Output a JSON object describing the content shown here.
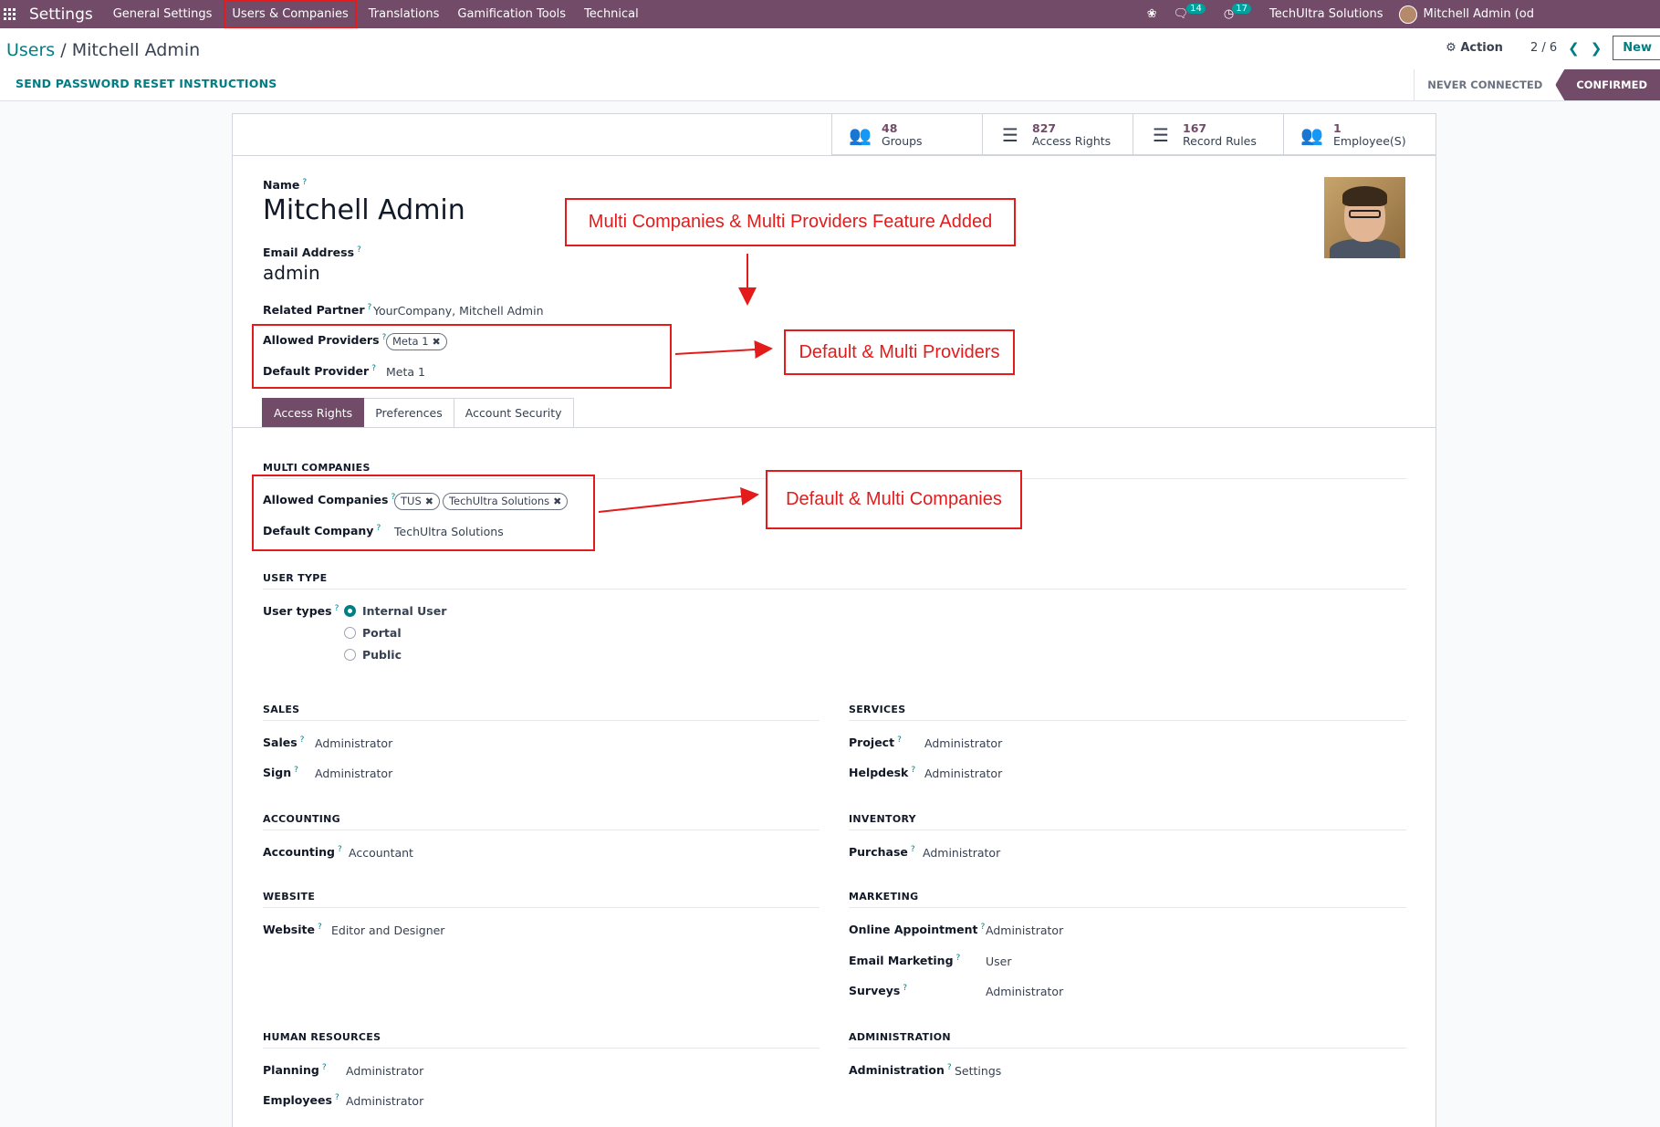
{
  "navbar": {
    "brand": "Settings",
    "menus": [
      "General Settings",
      "Users & Companies",
      "Translations",
      "Gamification Tools",
      "Technical"
    ],
    "messages_count": "14",
    "activities_count": "17",
    "company": "TechUltra Solutions",
    "user": "Mitchell Admin (od"
  },
  "control_panel": {
    "breadcrumb_parent": "Users",
    "breadcrumb_sep": "/",
    "breadcrumb_current": "Mitchell Admin",
    "action_label": "Action",
    "pager": "2 / 6",
    "new_label": "New",
    "reset_button": "SEND PASSWORD RESET INSTRUCTIONS",
    "status_never": "NEVER CONNECTED",
    "status_confirmed": "CONFIRMED"
  },
  "smart_buttons": [
    {
      "value": "48",
      "label": "Groups",
      "icon": "users-icon"
    },
    {
      "value": "827",
      "label": "Access Rights",
      "icon": "list-icon"
    },
    {
      "value": "167",
      "label": "Record Rules",
      "icon": "list-icon"
    },
    {
      "value": "1",
      "label": "Employee(S)",
      "icon": "users-icon"
    }
  ],
  "form": {
    "name_label": "Name",
    "name": "Mitchell Admin",
    "email_label": "Email Address",
    "email": "admin",
    "related_partner_label": "Related Partner",
    "related_partner": "YourCompany, Mitchell Admin",
    "allowed_providers_label": "Allowed Providers",
    "allowed_providers": [
      "Meta 1"
    ],
    "default_provider_label": "Default Provider",
    "default_provider": "Meta 1"
  },
  "tabs": [
    "Access Rights",
    "Preferences",
    "Account Security"
  ],
  "multi_companies": {
    "title": "MULTI COMPANIES",
    "allowed_label": "Allowed Companies",
    "allowed": [
      "TUS",
      "TechUltra Solutions"
    ],
    "default_label": "Default Company",
    "default": "TechUltra Solutions"
  },
  "user_type": {
    "title": "USER TYPE",
    "label": "User types",
    "options": [
      "Internal User",
      "Portal",
      "Public"
    ],
    "selected": "Internal User"
  },
  "sections": {
    "sales": {
      "title": "SALES",
      "rows": [
        {
          "label": "Sales",
          "value": "Administrator"
        },
        {
          "label": "Sign",
          "value": "Administrator"
        }
      ]
    },
    "services": {
      "title": "SERVICES",
      "rows": [
        {
          "label": "Project",
          "value": "Administrator"
        },
        {
          "label": "Helpdesk",
          "value": "Administrator"
        }
      ]
    },
    "accounting": {
      "title": "ACCOUNTING",
      "rows": [
        {
          "label": "Accounting",
          "value": "Accountant"
        }
      ]
    },
    "inventory": {
      "title": "INVENTORY",
      "rows": [
        {
          "label": "Purchase",
          "value": "Administrator"
        }
      ]
    },
    "website": {
      "title": "WEBSITE",
      "rows": [
        {
          "label": "Website",
          "value": "Editor and Designer"
        }
      ]
    },
    "marketing": {
      "title": "MARKETING",
      "rows": [
        {
          "label": "Online Appointment",
          "value": "Administrator"
        },
        {
          "label": "Email Marketing",
          "value": "User"
        },
        {
          "label": "Surveys",
          "value": "Administrator"
        }
      ]
    },
    "hr": {
      "title": "HUMAN RESOURCES",
      "rows": [
        {
          "label": "Planning",
          "value": "Administrator"
        },
        {
          "label": "Employees",
          "value": "Administrator"
        }
      ]
    },
    "administration": {
      "title": "ADMINISTRATION",
      "rows": [
        {
          "label": "Administration",
          "value": "Settings"
        }
      ]
    }
  },
  "annotations": {
    "feature": "Multi Companies & Multi Providers Feature Added",
    "providers": "Default & Multi Providers",
    "companies": "Default & Multi Companies"
  },
  "colors": {
    "brand": "#714b67",
    "accent": "#017e84",
    "annotation": "#e31b1b"
  }
}
